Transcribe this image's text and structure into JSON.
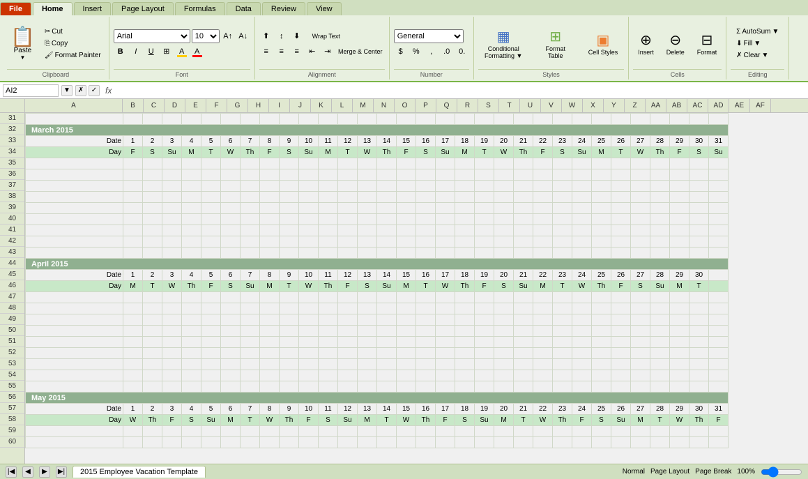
{
  "tabs": {
    "items": [
      "File",
      "Home",
      "Insert",
      "Page Layout",
      "Formulas",
      "Data",
      "Review",
      "View"
    ],
    "active": "Home"
  },
  "ribbon": {
    "groups": {
      "clipboard": {
        "label": "Clipboard",
        "paste": "Paste",
        "cut": "Cut",
        "copy": "Copy",
        "format_painter": "Format Painter"
      },
      "font": {
        "label": "Font",
        "font_name": "Arial",
        "font_size": "10",
        "bold": "B",
        "italic": "I",
        "underline": "U"
      },
      "alignment": {
        "label": "Alignment",
        "wrap_text": "Wrap Text",
        "merge_center": "Merge & Center"
      },
      "number": {
        "label": "Number",
        "format": "General"
      },
      "styles": {
        "label": "Styles",
        "conditional_formatting": "Conditional Formatting",
        "format_as_table": "Format Table",
        "cell_styles": "Cell Styles"
      },
      "cells": {
        "label": "Cells",
        "insert": "Insert",
        "delete": "Delete",
        "format": "Format"
      },
      "editing": {
        "label": "Editing",
        "autosum": "AutoSum",
        "fill": "Fill",
        "clear": "Clear"
      }
    }
  },
  "formula_bar": {
    "cell_ref": "AI2",
    "fx": "fx"
  },
  "columns": {
    "row_col": "",
    "headers": [
      "A",
      "B",
      "C",
      "D",
      "E",
      "F",
      "G",
      "H",
      "I",
      "J",
      "K",
      "L",
      "M",
      "N",
      "O",
      "P",
      "Q",
      "R",
      "S",
      "T",
      "U",
      "V",
      "W",
      "X",
      "Y",
      "Z",
      "AA",
      "AB",
      "AC",
      "AD",
      "AE",
      "AF"
    ]
  },
  "rows": [
    {
      "num": 31,
      "type": "empty"
    },
    {
      "num": 32,
      "type": "month",
      "label": "March 2015"
    },
    {
      "num": 33,
      "type": "date",
      "label": "Date",
      "values": [
        "1",
        "2",
        "3",
        "4",
        "5",
        "6",
        "7",
        "8",
        "9",
        "10",
        "11",
        "12",
        "13",
        "14",
        "15",
        "16",
        "17",
        "18",
        "19",
        "20",
        "21",
        "22",
        "23",
        "24",
        "25",
        "26",
        "27",
        "28",
        "29",
        "30",
        "31"
      ]
    },
    {
      "num": 34,
      "type": "day",
      "label": "Day",
      "values": [
        "F",
        "S",
        "Su",
        "M",
        "T",
        "W",
        "Th",
        "F",
        "S",
        "Su",
        "M",
        "T",
        "W",
        "Th",
        "F",
        "S",
        "Su",
        "M",
        "T",
        "W",
        "Th",
        "F",
        "S",
        "Su",
        "M",
        "T",
        "W",
        "Th",
        "F",
        "S",
        "Su"
      ]
    },
    {
      "num": 35,
      "type": "empty"
    },
    {
      "num": 36,
      "type": "empty"
    },
    {
      "num": 37,
      "type": "empty"
    },
    {
      "num": 38,
      "type": "empty"
    },
    {
      "num": 39,
      "type": "empty"
    },
    {
      "num": 40,
      "type": "empty"
    },
    {
      "num": 41,
      "type": "empty"
    },
    {
      "num": 42,
      "type": "empty"
    },
    {
      "num": 43,
      "type": "empty"
    },
    {
      "num": 44,
      "type": "month",
      "label": "April 2015"
    },
    {
      "num": 45,
      "type": "date",
      "label": "Date",
      "values": [
        "1",
        "2",
        "3",
        "4",
        "5",
        "6",
        "7",
        "8",
        "9",
        "10",
        "11",
        "12",
        "13",
        "14",
        "15",
        "16",
        "17",
        "18",
        "19",
        "20",
        "21",
        "22",
        "23",
        "24",
        "25",
        "26",
        "27",
        "28",
        "29",
        "30"
      ]
    },
    {
      "num": 46,
      "type": "day",
      "label": "Day",
      "values": [
        "M",
        "T",
        "W",
        "Th",
        "F",
        "S",
        "Su",
        "M",
        "T",
        "W",
        "Th",
        "F",
        "S",
        "Su",
        "M",
        "T",
        "W",
        "Th",
        "F",
        "S",
        "Su",
        "M",
        "T",
        "W",
        "Th",
        "F",
        "S",
        "Su",
        "M",
        "T"
      ]
    },
    {
      "num": 47,
      "type": "empty"
    },
    {
      "num": 48,
      "type": "empty"
    },
    {
      "num": 49,
      "type": "empty"
    },
    {
      "num": 50,
      "type": "empty"
    },
    {
      "num": 51,
      "type": "empty"
    },
    {
      "num": 52,
      "type": "empty"
    },
    {
      "num": 53,
      "type": "empty"
    },
    {
      "num": 54,
      "type": "empty"
    },
    {
      "num": 55,
      "type": "empty"
    },
    {
      "num": 56,
      "type": "month",
      "label": "May 2015"
    },
    {
      "num": 57,
      "type": "date",
      "label": "Date",
      "values": [
        "1",
        "2",
        "3",
        "4",
        "5",
        "6",
        "7",
        "8",
        "9",
        "10",
        "11",
        "12",
        "13",
        "14",
        "15",
        "16",
        "17",
        "18",
        "19",
        "20",
        "21",
        "22",
        "23",
        "24",
        "25",
        "26",
        "27",
        "28",
        "29",
        "30",
        "31"
      ]
    },
    {
      "num": 58,
      "type": "day",
      "label": "Day",
      "values": [
        "W",
        "Th",
        "F",
        "S",
        "Su",
        "M",
        "T",
        "W",
        "Th",
        "F",
        "S",
        "Su",
        "M",
        "T",
        "W",
        "Th",
        "F",
        "S",
        "Su",
        "M",
        "T",
        "W",
        "Th",
        "F",
        "S",
        "Su",
        "M",
        "T",
        "W",
        "Th",
        "F"
      ]
    },
    {
      "num": 59,
      "type": "empty"
    },
    {
      "num": 60,
      "type": "empty"
    }
  ],
  "status_bar": {
    "sheet_tab": "2015 Employee Vacation Template"
  }
}
